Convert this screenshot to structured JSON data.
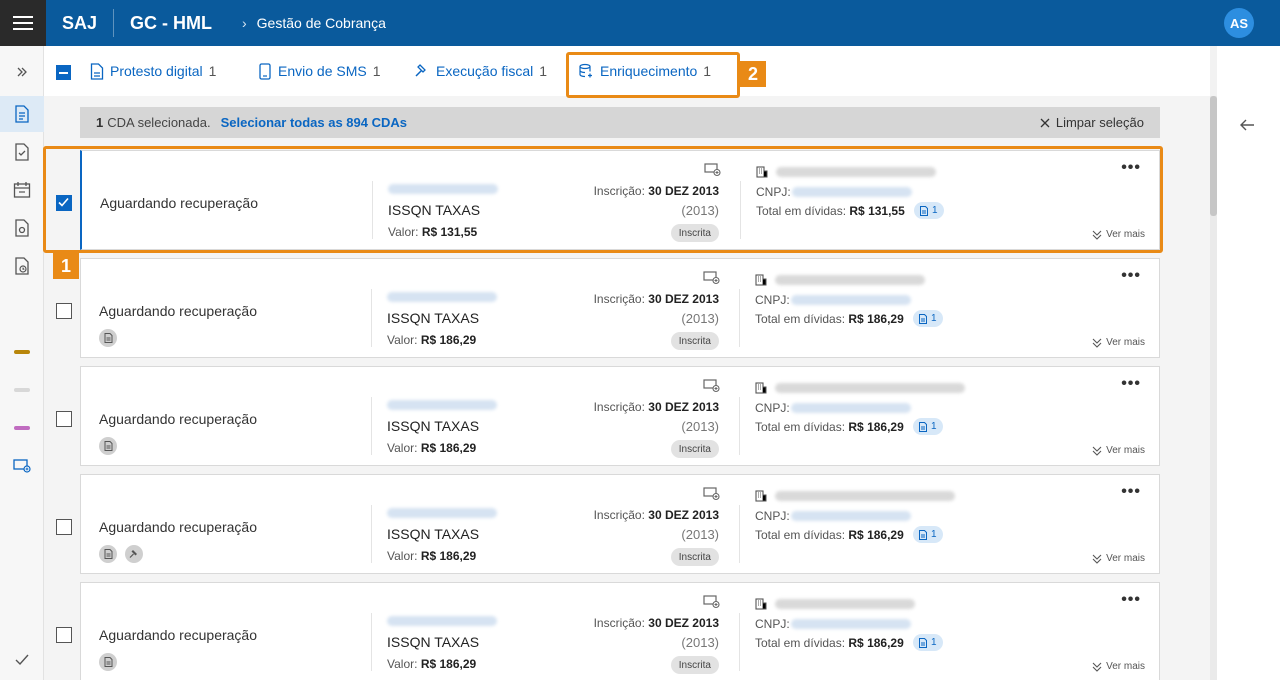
{
  "app": {
    "brand": "SAJ",
    "product": "GC - HML",
    "breadcrumb": "Gestão de Cobrança",
    "user_initials": "AS"
  },
  "tabs": [
    {
      "label": "Protesto digital",
      "count": "1",
      "icon": "document-stamp-icon"
    },
    {
      "label": "Envio de SMS",
      "count": "1",
      "icon": "phone-message-icon"
    },
    {
      "label": "Execução fiscal",
      "count": "1",
      "icon": "gavel-icon"
    },
    {
      "label": "Enriquecimento",
      "count": "1",
      "icon": "database-icon"
    }
  ],
  "selection": {
    "count": "1",
    "text": "CDA selecionada.",
    "select_all": "Selecionar todas as 894 CDAs",
    "clear": "Limpar seleção"
  },
  "card_labels": {
    "inscricao_label": "Inscrição:",
    "valor_label": "Valor:",
    "cnpj_label": "CNPJ:",
    "total_label": "Total em dívidas:",
    "ver_mais": "Ver mais",
    "more": "•••"
  },
  "cards": [
    {
      "status": "Aguardando recuperação",
      "tax": "ISSQN TAXAS",
      "valor": "R$ 131,55",
      "date": "30 DEZ 2013",
      "year": "(2013)",
      "pill": "Inscrita",
      "total": "R$ 131,55",
      "docs": "1",
      "checked": true
    },
    {
      "status": "Aguardando recuperação",
      "tax": "ISSQN TAXAS",
      "valor": "R$ 186,29",
      "date": "30 DEZ 2013",
      "year": "(2013)",
      "pill": "Inscrita",
      "total": "R$ 186,29",
      "docs": "1",
      "checked": false
    },
    {
      "status": "Aguardando recuperação",
      "tax": "ISSQN TAXAS",
      "valor": "R$ 186,29",
      "date": "30 DEZ 2013",
      "year": "(2013)",
      "pill": "Inscrita",
      "total": "R$ 186,29",
      "docs": "1",
      "checked": false
    },
    {
      "status": "Aguardando recuperação",
      "tax": "ISSQN TAXAS",
      "valor": "R$ 186,29",
      "date": "30 DEZ 2013",
      "year": "(2013)",
      "pill": "Inscrita",
      "total": "R$ 186,29",
      "docs": "1",
      "checked": false
    },
    {
      "status": "Aguardando recuperação",
      "tax": "ISSQN TAXAS",
      "valor": "R$ 186,29",
      "date": "30 DEZ 2013",
      "year": "(2013)",
      "pill": "Inscrita",
      "total": "R$ 186,29",
      "docs": "1",
      "checked": false
    }
  ],
  "callouts": {
    "one": "1",
    "two": "2"
  },
  "colors": {
    "primary": "#0a5a9c",
    "accent": "#0a66c2",
    "callout": "#e98a16"
  }
}
